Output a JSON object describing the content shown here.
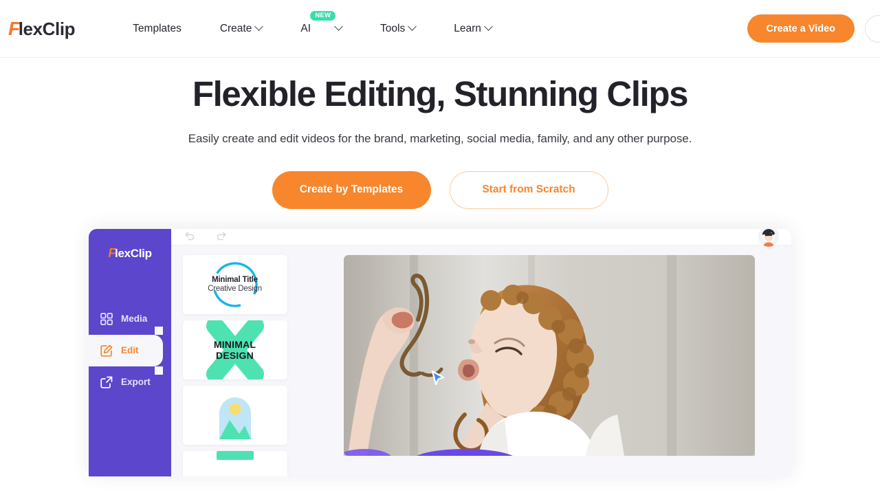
{
  "header": {
    "logo": {
      "accent": "F",
      "rest": "lexClip",
      "accent_color": "#f2792c"
    },
    "nav": [
      {
        "label": "Templates",
        "has_chevron": false,
        "badge": null
      },
      {
        "label": "Create",
        "has_chevron": true,
        "badge": null
      },
      {
        "label": "AI",
        "has_chevron": true,
        "badge": "NEW"
      },
      {
        "label": "Tools",
        "has_chevron": true,
        "badge": null
      },
      {
        "label": "Learn",
        "has_chevron": true,
        "badge": null
      }
    ],
    "cta_label": "Create a Video",
    "cta_color": "#f7862c"
  },
  "hero": {
    "title": "Flexible Editing, Stunning Clips",
    "subtitle": "Easily create and edit videos for the brand, marketing, social media, family, and any other purpose.",
    "primary_button": "Create by Templates",
    "secondary_button": "Start from Scratch"
  },
  "editor": {
    "logo": {
      "accent": "F",
      "rest": "lexClip"
    },
    "sidebar_color": "#5b46cc",
    "items": [
      {
        "label": "Media",
        "icon": "grid-icon",
        "active": false
      },
      {
        "label": "Edit",
        "icon": "pencil-square-icon",
        "active": true
      },
      {
        "label": "Export",
        "icon": "export-icon",
        "active": false
      }
    ],
    "toolbar": [
      {
        "icon": "undo-icon"
      },
      {
        "icon": "redo-icon"
      }
    ],
    "templates": [
      {
        "line1": "Minimal Title",
        "line2": "Creative Design",
        "style": "circle-outline",
        "accent": "#17b5e8"
      },
      {
        "line1": "MINIMAL",
        "line2": "DESIGN",
        "style": "brush-x",
        "accent": "#4ee2b1"
      },
      {
        "line1": "",
        "line2": "",
        "style": "image-placeholder",
        "accent": "#4ee2b1"
      },
      {
        "line1": "",
        "line2": "",
        "style": "partial",
        "accent": "#4ee2b1"
      }
    ],
    "cursor": "pointer-cursor"
  }
}
